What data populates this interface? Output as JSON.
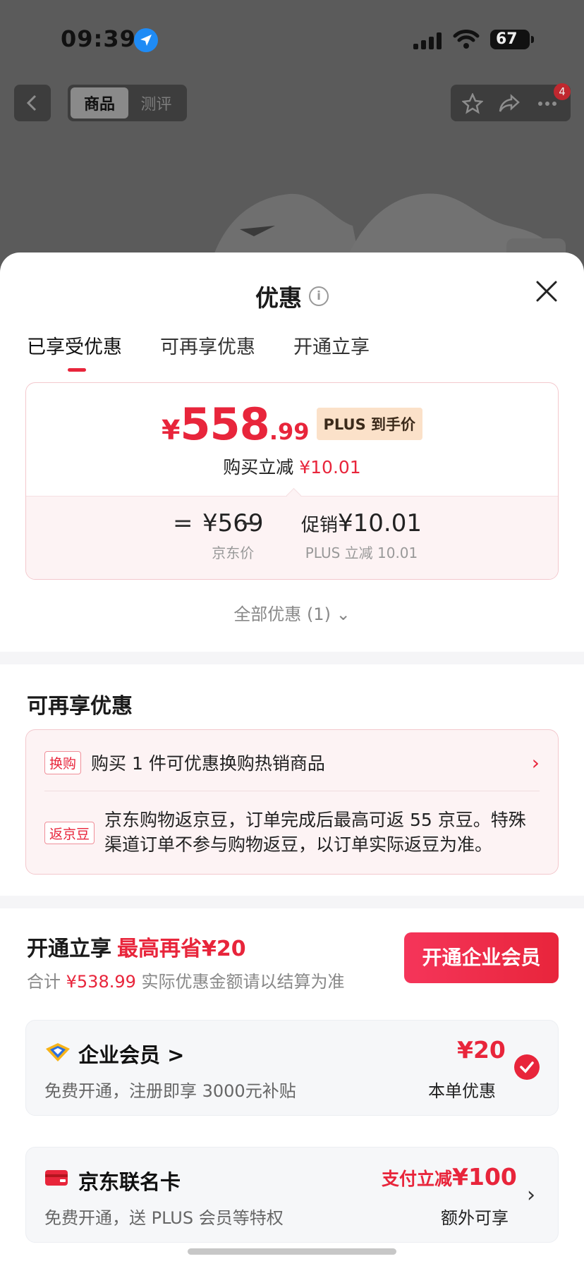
{
  "status_bar": {
    "time": "09:39",
    "battery": "67"
  },
  "nav": {
    "tab_active": "商品",
    "tab_inactive": "测评",
    "notif_count": "4"
  },
  "sheet": {
    "title": "优惠",
    "tabs": [
      "已享受优惠",
      "可再享优惠",
      "开通立享"
    ]
  },
  "price_card": {
    "currency": "¥",
    "price_int": "558",
    "price_dec": ".99",
    "plus_tag": "PLUS 到手价",
    "direct_label": "购买立减",
    "direct_amount": "¥10.01",
    "eq_sign": "=",
    "minus_sign": "−",
    "jd_price": "¥569",
    "jd_price_label": "京东价",
    "promo_prefix": "促销",
    "promo_amount": "¥10.01",
    "promo_label": "PLUS 立减 10.01"
  },
  "all_offers": "全部优惠 (1)",
  "extra": {
    "title": "可再享优惠",
    "items": [
      {
        "tag": "换购",
        "text": "购买 1 件可优惠换购热销商品"
      },
      {
        "tag": "返京豆",
        "text": "京东购物返京豆，订单完成后最高可返 55 京豆。特殊渠道订单不参与购物返豆，以订单实际返豆为准。"
      }
    ]
  },
  "open": {
    "title": "开通立享",
    "save": "最高再省¥20",
    "total_prefix": "合计",
    "total_amount": "¥538.99",
    "total_suffix": "实际优惠金额请以结算为准",
    "button": "开通企业会员"
  },
  "member_cards": [
    {
      "name": "企业会员 >",
      "desc": "免费开通，注册即享 3000元补贴",
      "amount": "¥20",
      "sub": "本单优惠",
      "checked": true
    },
    {
      "name": "京东联名卡",
      "desc": "免费开通，送 PLUS 会员等特权",
      "amount_prefix": "支付立减",
      "amount": "¥100",
      "sub": "额外可享"
    }
  ],
  "colors": {
    "accent": "#e8253b",
    "plus_tag_bg": "#fbe1c9",
    "sheet_bg": "#ffffff",
    "dim_bg": "#5b5b5b"
  }
}
